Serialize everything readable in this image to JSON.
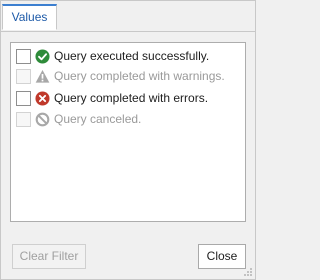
{
  "tabs": [
    {
      "label": "Values",
      "active": true
    }
  ],
  "items": [
    {
      "label": "Query executed successfully.",
      "icon": "success-check-icon",
      "enabled": true,
      "checked": false
    },
    {
      "label": "Query completed with warnings.",
      "icon": "warning-icon",
      "enabled": false,
      "checked": false
    },
    {
      "label": "Query completed with errors.",
      "icon": "error-icon",
      "enabled": true,
      "checked": false
    },
    {
      "label": "Query canceled.",
      "icon": "canceled-icon",
      "enabled": false,
      "checked": false
    }
  ],
  "buttons": {
    "clear_filter": "Clear Filter",
    "close": "Close"
  },
  "colors": {
    "accent": "#3c7fd0",
    "success": "#2e8b3a",
    "error": "#c0392b",
    "disabled_icon": "#a8a8a8"
  }
}
